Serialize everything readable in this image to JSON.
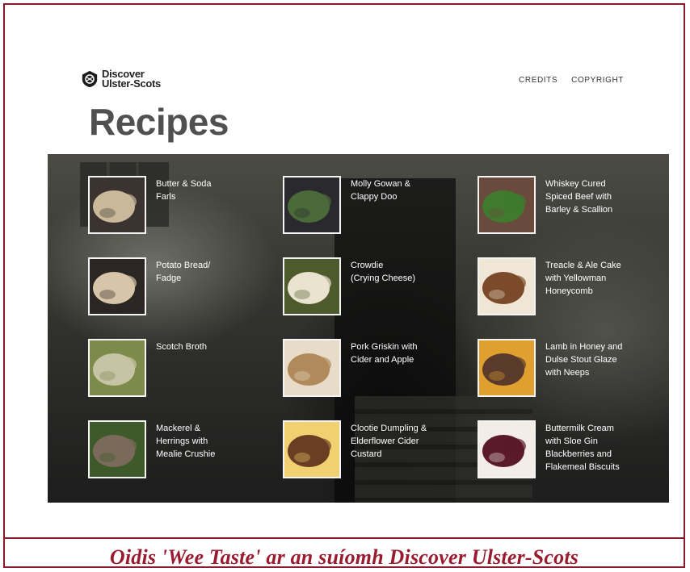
{
  "site": {
    "logo_line1": "Discover",
    "logo_line2": "Ulster-Scots",
    "logo_icon": "shield-knot-icon"
  },
  "nav": {
    "credits": "CREDITS",
    "copyright": "COPYRIGHT"
  },
  "page": {
    "title": "Recipes"
  },
  "recipes": [
    {
      "title": "Butter & Soda\nFarls",
      "image": "soda-farls-photo",
      "tone": [
        "#c9b89a",
        "#3a3330"
      ]
    },
    {
      "title": "Molly Gowan &\nClappy Doo",
      "image": "mussels-photo",
      "tone": [
        "#4a6a3a",
        "#2a2a2e"
      ]
    },
    {
      "title": "Whiskey Cured\nSpiced Beef with\nBarley & Scallion",
      "image": "spiced-beef-photo",
      "tone": [
        "#3f7a2e",
        "#6b4a3e"
      ]
    },
    {
      "title": "Potato Bread/\nFadge",
      "image": "potato-bread-photo",
      "tone": [
        "#d8c4a8",
        "#2b2624"
      ]
    },
    {
      "title": "Crowdie\n(Crying Cheese)",
      "image": "crowdie-photo",
      "tone": [
        "#e9e3cf",
        "#4d5a2c"
      ]
    },
    {
      "title": "Treacle & Ale Cake\nwith Yellowman\nHoneycomb",
      "image": "treacle-cake-photo",
      "tone": [
        "#7a4a2a",
        "#efe6d6"
      ]
    },
    {
      "title": "Scotch Broth",
      "image": "scotch-broth-photo",
      "tone": [
        "#c7c4a6",
        "#7c8a4a"
      ]
    },
    {
      "title": "Pork Griskin with\nCider and Apple",
      "image": "pork-griskin-photo",
      "tone": [
        "#b08a5a",
        "#e8dcc8"
      ]
    },
    {
      "title": "Lamb in Honey and\nDulse Stout Glaze\nwith Neeps",
      "image": "lamb-neeps-photo",
      "tone": [
        "#5a3a2a",
        "#e0a030"
      ]
    },
    {
      "title": "Mackerel &\nHerrings with\nMealie Crushie",
      "image": "mackerel-photo",
      "tone": [
        "#7a6a5a",
        "#3e5a2a"
      ]
    },
    {
      "title": "Clootie Dumpling &\nElderflower Cider\nCustard",
      "image": "clootie-dumpling-photo",
      "tone": [
        "#6a3e22",
        "#f0d070"
      ]
    },
    {
      "title": "Buttermilk Cream\nwith Sloe Gin\nBlackberries and\nFlakemeal Biscuits",
      "image": "buttermilk-cream-photo",
      "tone": [
        "#5a1a2a",
        "#f2ede6"
      ]
    }
  ],
  "caption": "Oidis 'Wee Taste' ar an suíomh Discover Ulster-Scots",
  "colors": {
    "border": "#8b1a2e",
    "caption": "#9a1b2f",
    "title_grey": "#505050"
  }
}
